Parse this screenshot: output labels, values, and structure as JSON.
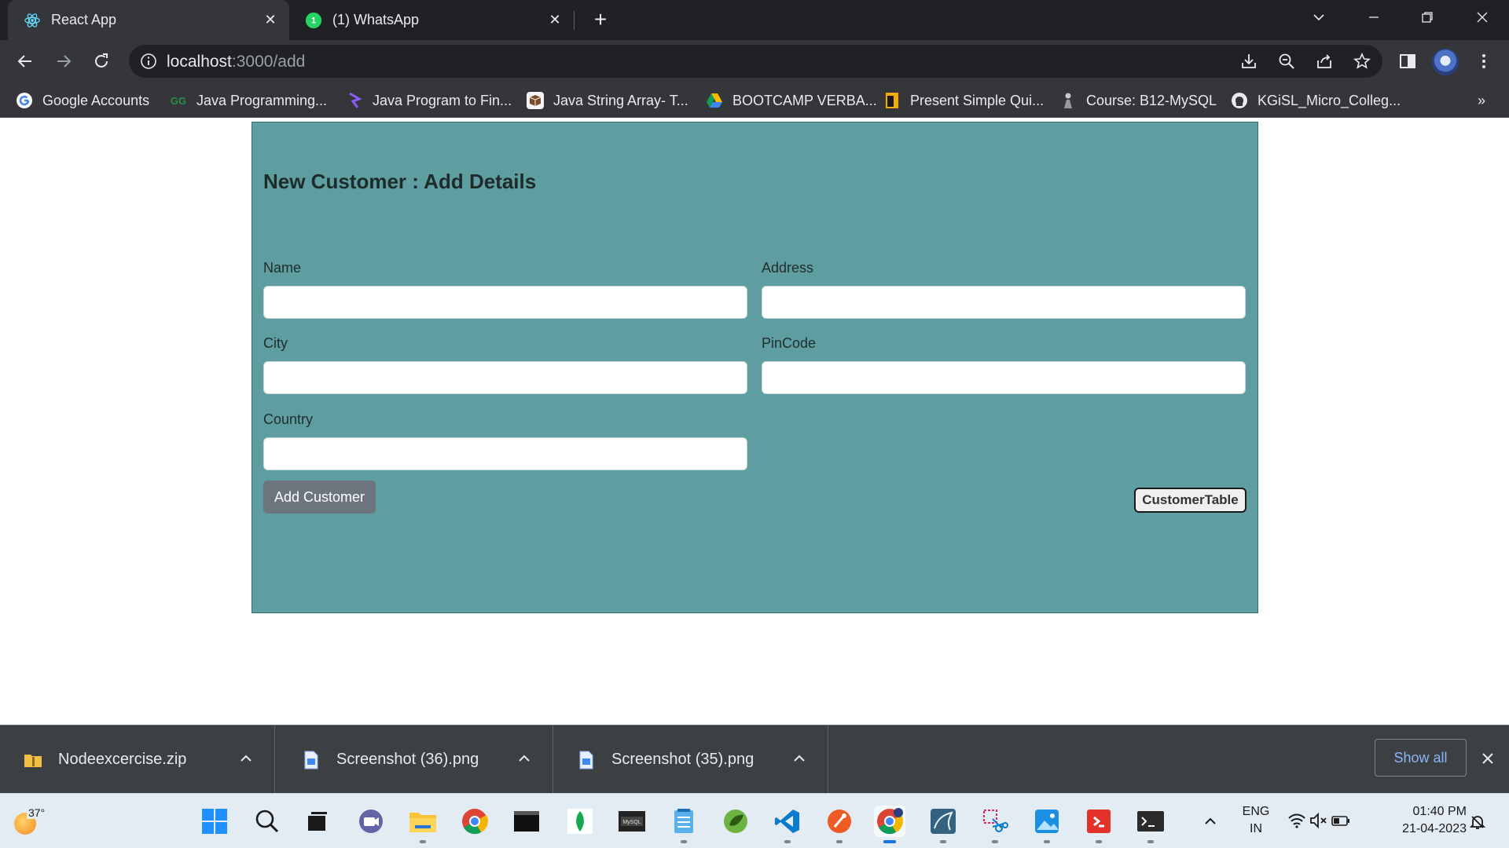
{
  "tabs": [
    {
      "title": "React App",
      "icon": "react-icon",
      "active": true
    },
    {
      "title": "(1) WhatsApp",
      "icon": "whatsapp-icon",
      "active": false
    }
  ],
  "address": {
    "host": "localhost",
    "path": ":3000/add"
  },
  "bookmarks": [
    {
      "label": "Google Accounts",
      "icon": "google-icon"
    },
    {
      "label": "Java Programming...",
      "icon": "geeksforgeeks-icon"
    },
    {
      "label": "Java Program to Fin...",
      "icon": "prepinsta-icon"
    },
    {
      "label": "Java String Array- T...",
      "icon": "box-icon"
    },
    {
      "label": "BOOTCAMP VERBA...",
      "icon": "google-drive-icon"
    },
    {
      "label": "Present Simple Qui...",
      "icon": "quiz-icon"
    },
    {
      "label": "Course: B12-MySQL",
      "icon": "course-icon"
    },
    {
      "label": "KGiSL_Micro_Colleg...",
      "icon": "github-icon"
    }
  ],
  "form": {
    "title": "New Customer : Add Details",
    "fields": {
      "name": {
        "label": "Name",
        "value": ""
      },
      "address": {
        "label": "Address",
        "value": ""
      },
      "city": {
        "label": "City",
        "value": ""
      },
      "pincode": {
        "label": "PinCode",
        "value": ""
      },
      "country": {
        "label": "Country",
        "value": ""
      }
    },
    "add_button": "Add Customer",
    "table_button": "CustomerTable"
  },
  "downloads": {
    "items": [
      {
        "name": "Nodeexcercise.zip",
        "icon": "zip-folder-icon"
      },
      {
        "name": "Screenshot (36).png",
        "icon": "image-file-icon"
      },
      {
        "name": "Screenshot (35).png",
        "icon": "image-file-icon"
      }
    ],
    "show_all": "Show all"
  },
  "taskbar": {
    "weather": "37°",
    "apps": [
      "start",
      "search",
      "task-view",
      "teams",
      "file-explorer",
      "chrome",
      "terminal-window",
      "mongodb",
      "mysql-workbench",
      "notepad",
      "spring-tools",
      "vscode",
      "postman",
      "chrome-profile",
      "mysql",
      "snipping-tool",
      "photos",
      "git",
      "terminal"
    ],
    "lang_line1": "ENG",
    "lang_line2": "IN",
    "time": "01:40 PM",
    "date": "21-04-2023"
  },
  "colors": {
    "card_bg": "#5f9ea0",
    "browser_dark": "#35363a",
    "add_button_bg": "#6c757d",
    "link_blue": "#8ab4f8"
  }
}
